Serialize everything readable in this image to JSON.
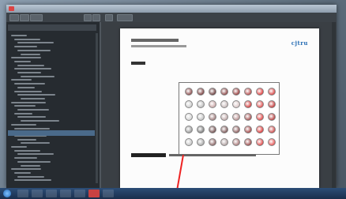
{
  "document": {
    "brand": "cjtru"
  },
  "swatches": [
    [
      "#8a4a4a",
      "#7a3d3d",
      "#6a3a3a",
      "#8c4646",
      "#963a3a",
      "#b54a4a",
      "#e23b3b",
      "#d94444"
    ],
    [
      "#cccccc",
      "#bdbdbd",
      "#c9a5a5",
      "#c7b8b8",
      "#d9c4c4",
      "#d33a3a",
      "#e05050",
      "#c43838"
    ],
    [
      "#d4d4d4",
      "#c3c3c3",
      "#9e7a7a",
      "#bfa8a8",
      "#b89090",
      "#a35050",
      "#e34646",
      "#b73c3c"
    ],
    [
      "#999999",
      "#7a7a7a",
      "#6e4a4a",
      "#7a5555",
      "#8a5a5a",
      "#a34545",
      "#df3535",
      "#cc4848"
    ],
    [
      "#c5c5c5",
      "#a8a8a8",
      "#8a6464",
      "#b0a0a0",
      "#a87878",
      "#9b4848",
      "#e24848",
      "#e65555"
    ]
  ],
  "colors": {
    "accent": "#2a6fb5",
    "red_pointer": "#e22222"
  }
}
